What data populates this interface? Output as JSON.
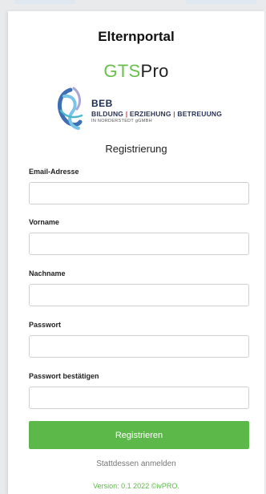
{
  "header": {
    "title": "Elternportal",
    "brand_prefix": "GTS",
    "brand_suffix": "Pro",
    "brand_accent_color": "#6abf4b"
  },
  "logo": {
    "name": "BEB",
    "line1": "BILDUNG",
    "line2": "ERZIEHUNG",
    "line3": "BETREUUNG",
    "separator": "|",
    "subtitle": "IN NORDERSTEDT gGMBH"
  },
  "form": {
    "title": "Registrierung",
    "fields": {
      "email_label": "Email-Adresse",
      "email_value": "",
      "vorname_label": "Vorname",
      "vorname_value": "",
      "nachname_label": "Nachname",
      "nachname_value": "",
      "passwort_label": "Passwort",
      "passwort_value": "",
      "passwort_confirm_label": "Passwort bestätigen",
      "passwort_confirm_value": ""
    },
    "submit_label": "Registrieren",
    "submit_color": "#5cb949",
    "login_link": "Stattdessen anmelden"
  },
  "footer": {
    "version": "Version: 0.1 2022 ©ivPRO."
  }
}
